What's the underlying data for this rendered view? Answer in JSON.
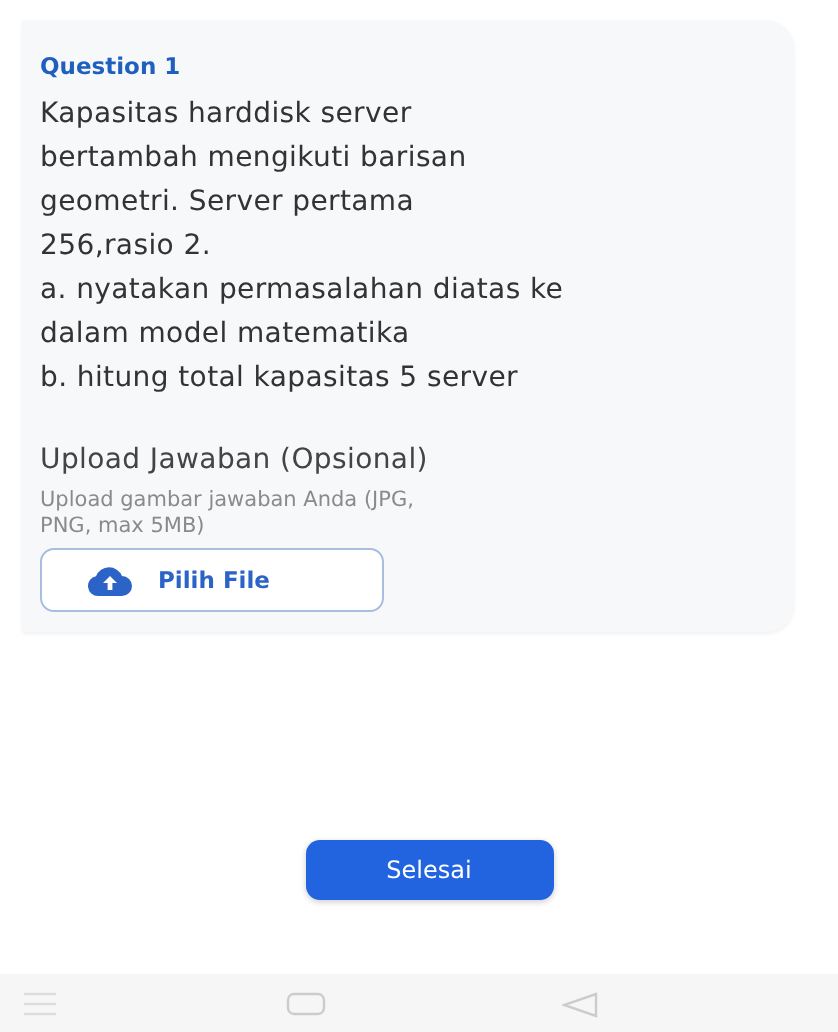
{
  "question": {
    "label": "Question 1",
    "text": "Kapasitas harddisk server\nbertambah mengikuti barisan\ngeometri. Server pertama\n256,rasio 2.\na. nyatakan permasalahan diatas ke\ndalam model matematika\nb. hitung total kapasitas 5 server"
  },
  "upload": {
    "title": "Upload Jawaban (Opsional)",
    "hint": "Upload gambar jawaban Anda (JPG,\nPNG, max 5MB)",
    "button": "Pilih File"
  },
  "finish_button": "Selesai"
}
